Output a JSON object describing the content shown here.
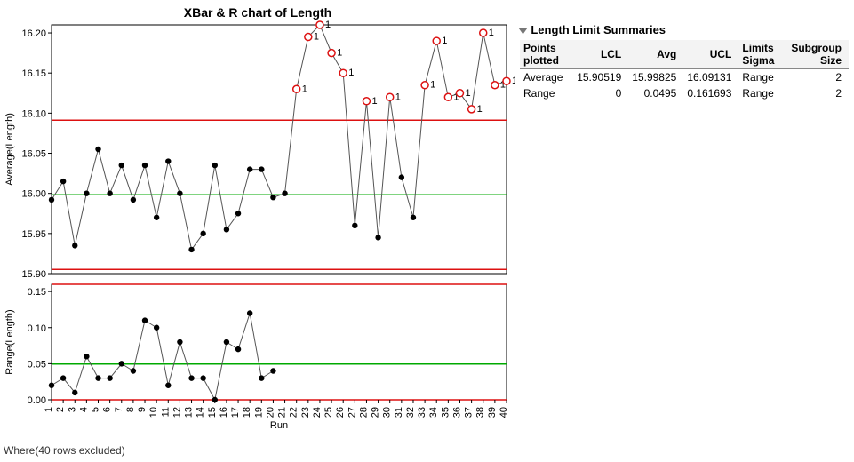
{
  "title": "XBar & R chart of Length",
  "footer": "Where(40 rows excluded)",
  "side": {
    "header": "Length Limit Summaries",
    "columns": [
      "Points plotted",
      "LCL",
      "Avg",
      "UCL",
      "Limits Sigma",
      "Subgroup Size"
    ],
    "rows": [
      {
        "label": "Average",
        "lcl": "15.90519",
        "avg": "15.99825",
        "ucl": "16.09131",
        "sigma": "Range",
        "size": "2"
      },
      {
        "label": "Range",
        "lcl": "0",
        "avg": "0.0495",
        "ucl": "0.161693",
        "sigma": "Range",
        "size": "2"
      }
    ]
  },
  "chart_data": [
    {
      "type": "line",
      "name": "XBar",
      "title": "XBar & R chart of Length",
      "xlabel": "Run",
      "ylabel": "Average(Length)",
      "ylim": [
        15.9,
        16.21
      ],
      "yticks": [
        15.9,
        15.95,
        16.0,
        16.05,
        16.1,
        16.15,
        16.2
      ],
      "center": 15.99825,
      "lcl": 15.90519,
      "ucl": 16.09131,
      "x": [
        1,
        2,
        3,
        4,
        5,
        6,
        7,
        8,
        9,
        10,
        11,
        12,
        13,
        14,
        15,
        16,
        17,
        18,
        19,
        20,
        21,
        22,
        23,
        24,
        25,
        26,
        27,
        28,
        29,
        30,
        31,
        32,
        33,
        34,
        35,
        36,
        37,
        38,
        39,
        40
      ],
      "values": [
        15.992,
        16.015,
        15.935,
        16.0,
        16.055,
        16.0,
        16.035,
        15.992,
        16.035,
        15.97,
        16.04,
        16.0,
        15.93,
        15.95,
        16.035,
        15.955,
        15.975,
        16.03,
        16.03,
        15.995,
        16.0,
        16.13,
        16.195,
        16.21,
        16.175,
        16.15,
        15.96,
        16.115,
        15.945,
        16.12,
        16.02,
        15.97,
        16.135,
        16.19,
        16.12,
        16.125,
        16.105,
        16.2,
        16.135,
        16.14
      ],
      "flag": [
        0,
        0,
        0,
        0,
        0,
        0,
        0,
        0,
        0,
        0,
        0,
        0,
        0,
        0,
        0,
        0,
        0,
        0,
        0,
        0,
        0,
        1,
        1,
        1,
        1,
        1,
        0,
        1,
        0,
        1,
        0,
        0,
        1,
        1,
        1,
        1,
        1,
        1,
        1,
        1
      ]
    },
    {
      "type": "line",
      "name": "R",
      "xlabel": "Run",
      "ylabel": "Range(Length)",
      "ylim": [
        0,
        0.16
      ],
      "yticks": [
        0,
        0.05,
        0.1,
        0.15
      ],
      "center": 0.0495,
      "lcl": 0,
      "ucl": 0.161693,
      "x": [
        1,
        2,
        3,
        4,
        5,
        6,
        7,
        8,
        9,
        10,
        11,
        12,
        13,
        14,
        15,
        16,
        17,
        18,
        19,
        20
      ],
      "values": [
        0.02,
        0.03,
        0.01,
        0.06,
        0.03,
        0.03,
        0.05,
        0.04,
        0.11,
        0.1,
        0.02,
        0.08,
        0.03,
        0.03,
        0.0,
        0.08,
        0.07,
        0.12,
        0.03,
        0.04
      ]
    }
  ]
}
